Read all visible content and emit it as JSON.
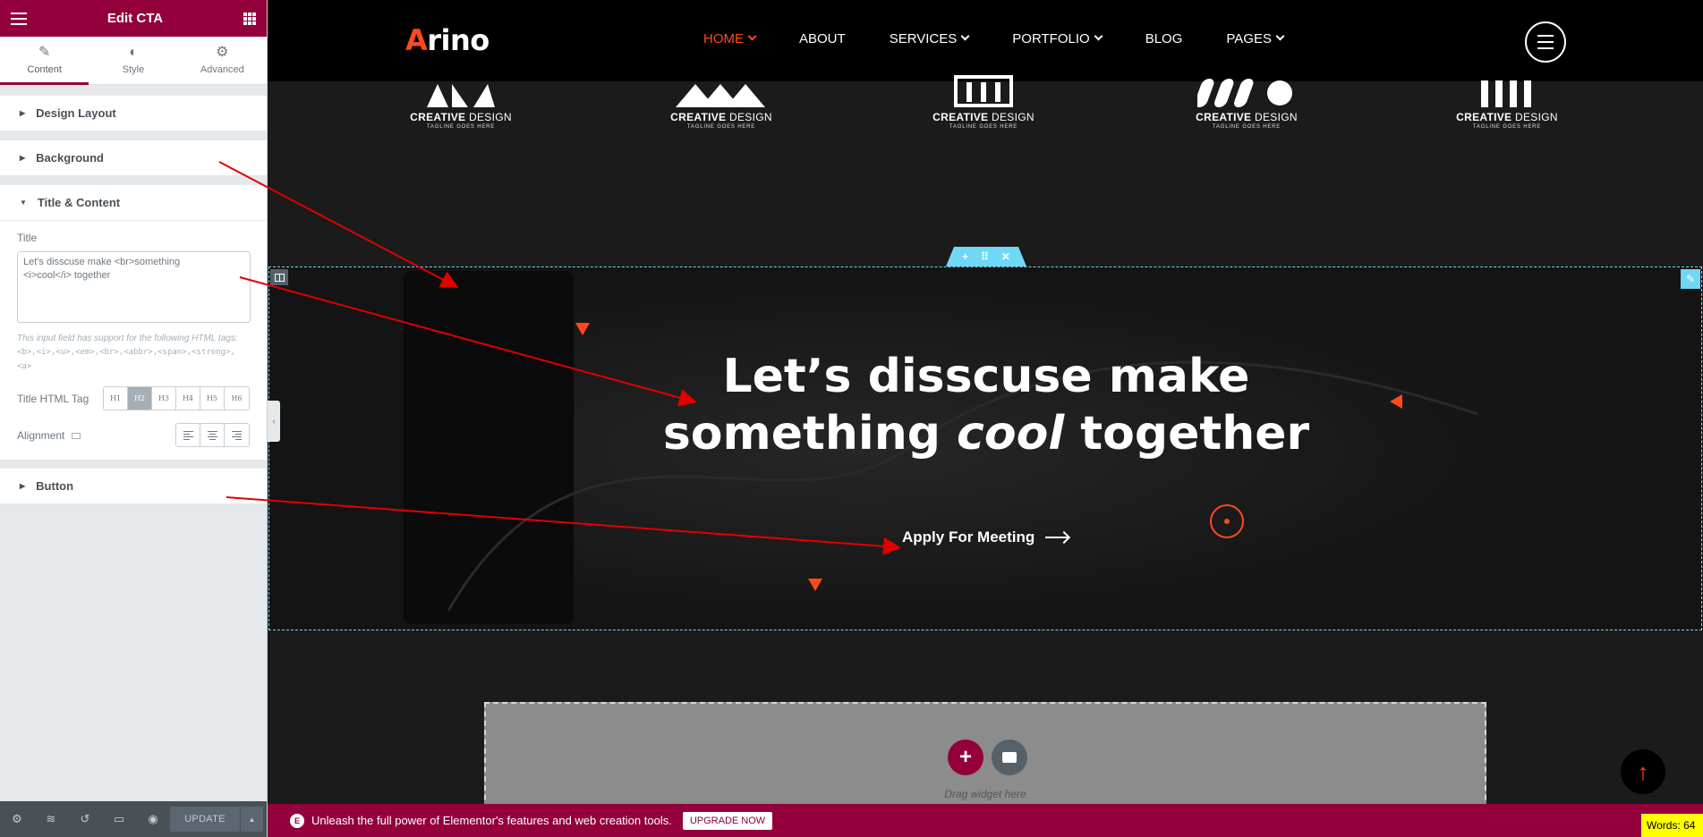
{
  "panel": {
    "title": "Edit CTA",
    "tabs": [
      {
        "label": "Content",
        "icon": "pencil-icon"
      },
      {
        "label": "Style",
        "icon": "contrast-icon"
      },
      {
        "label": "Advanced",
        "icon": "gear-icon"
      }
    ],
    "sections": {
      "design_layout": "Design Layout",
      "background": "Background",
      "title_content": "Title & Content",
      "button": "Button"
    },
    "title_label": "Title",
    "title_value": "Let's disscuse make <br>something\n<i>cool</i> together",
    "hint_text": "This input field has support for the following HTML tags:",
    "hint_tags": "<b>,<i>,<u>,<em>,<br>,<abbr>,<span>,<strong>,<a>",
    "title_html_tag_label": "Title HTML Tag",
    "html_tags": [
      "H1",
      "H2",
      "H3",
      "H4",
      "H5",
      "H6"
    ],
    "alignment_label": "Alignment",
    "update_label": "UPDATE",
    "accent": "#93003c"
  },
  "site": {
    "logo_first": "A",
    "logo_rest": "rino",
    "menu": [
      {
        "label": "HOME",
        "dropdown": true,
        "active": true
      },
      {
        "label": "ABOUT",
        "dropdown": false,
        "active": false
      },
      {
        "label": "SERVICES",
        "dropdown": true,
        "active": false
      },
      {
        "label": "PORTFOLIO",
        "dropdown": true,
        "active": false
      },
      {
        "label": "BLOG",
        "dropdown": false,
        "active": false
      },
      {
        "label": "PAGES",
        "dropdown": true,
        "active": false
      }
    ],
    "brands": [
      {
        "name_bold": "CREATIVE",
        "name_light": " DESIGN",
        "tagline": "TAGLINE GOES HERE"
      },
      {
        "name_bold": "CREATIVE",
        "name_light": " DESIGN",
        "tagline": "TAGLINE GOES HERE"
      },
      {
        "name_bold": "CREATIVE",
        "name_light": " DESIGN",
        "tagline": "TAGLINE GOES HERE"
      },
      {
        "name_bold": "CREATIVE",
        "name_light": " DESIGN",
        "tagline": "TAGLINE GOES HERE"
      },
      {
        "name_bold": "CREATIVE",
        "name_light": " DESIGN",
        "tagline": "TAGLINE GOES HERE"
      }
    ],
    "accent": "#ff4a1c"
  },
  "cta": {
    "title_line1": "Let’s disscuse make",
    "title_line2_pre": "something ",
    "title_line2_italic": "cool",
    "title_line2_post": " together",
    "button_label": "Apply For Meeting"
  },
  "drop_zone": {
    "label": "Drag widget here"
  },
  "promo": {
    "message": "Unleash the full power of Elementor's features and web creation tools.",
    "button": "UPGRADE NOW"
  },
  "words_counter": "Words: 64"
}
